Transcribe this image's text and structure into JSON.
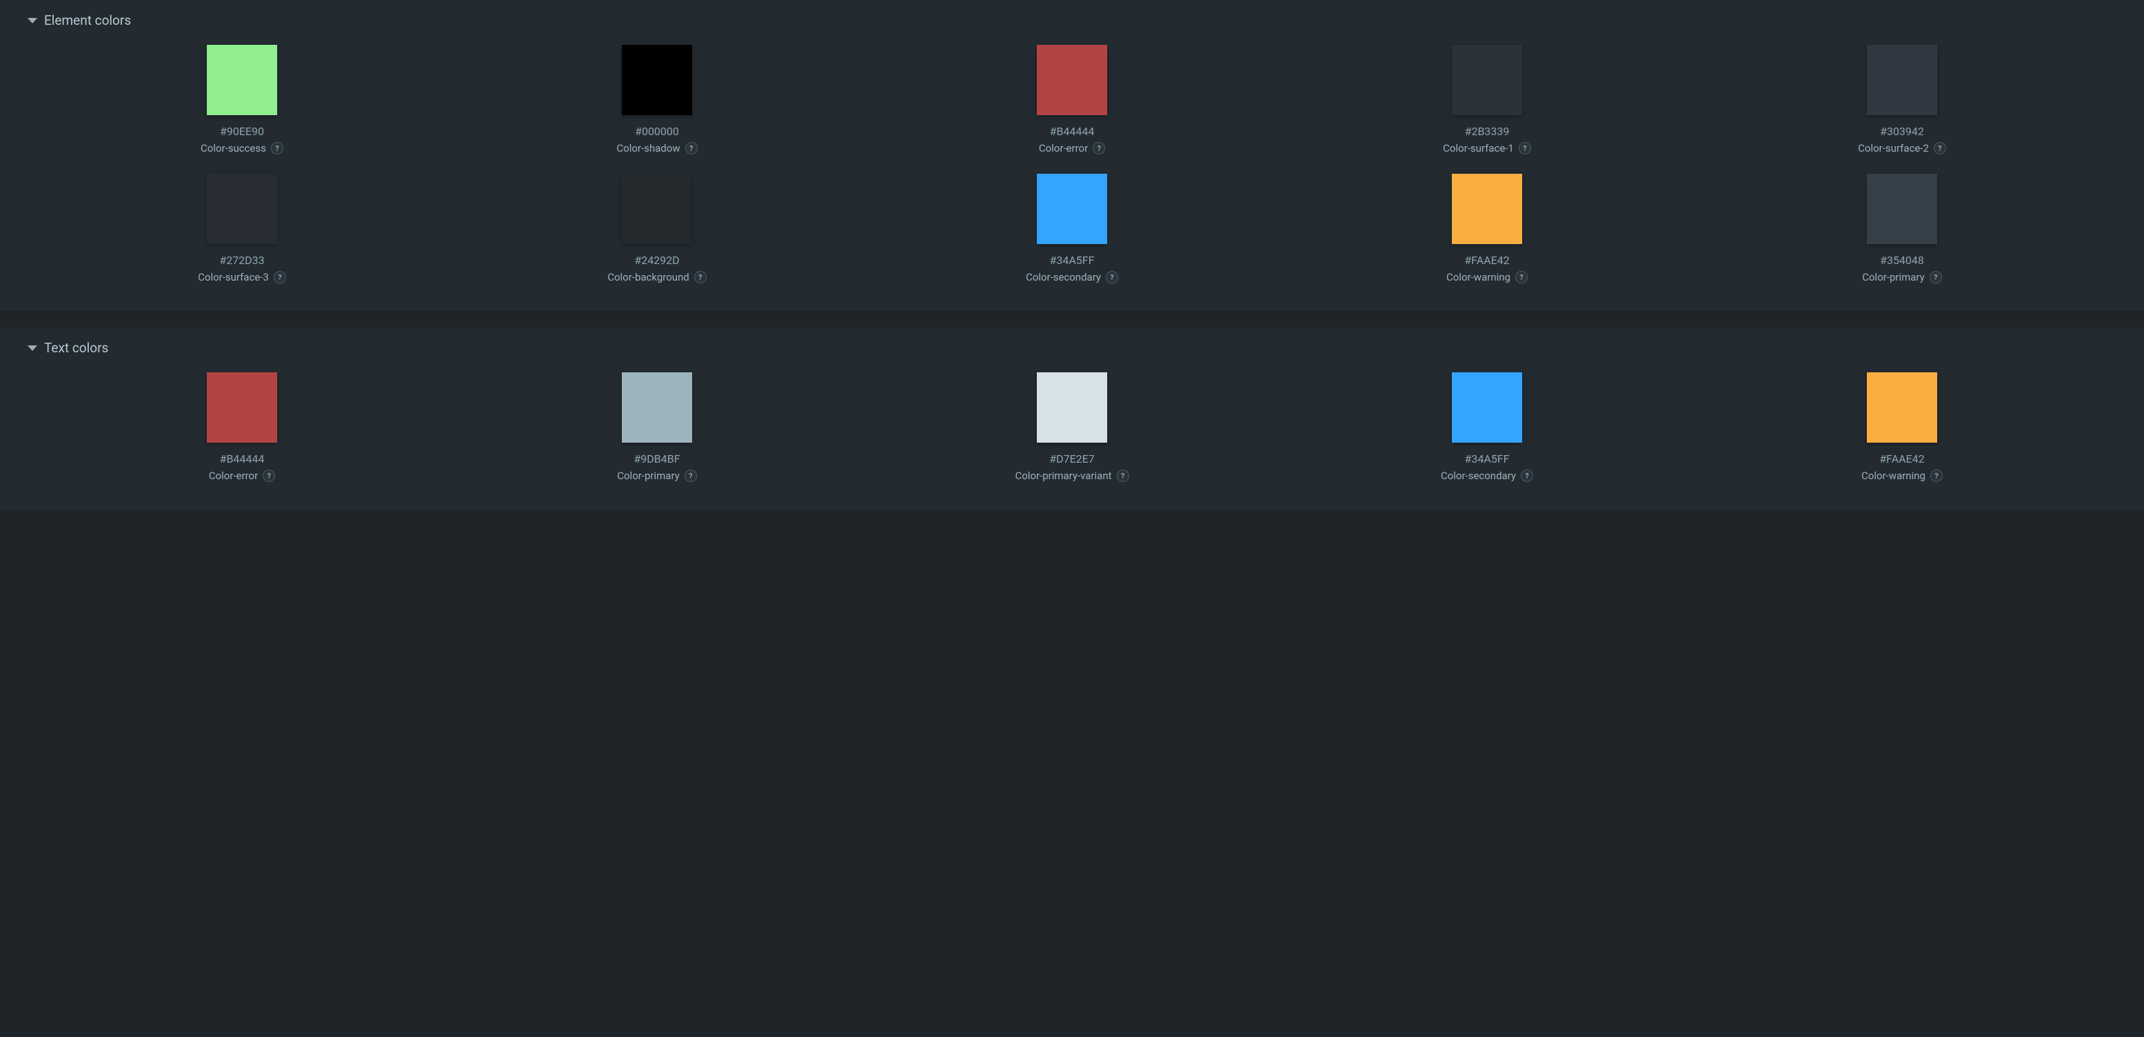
{
  "sections": [
    {
      "title": "Element colors",
      "swatches": [
        {
          "hex": "#90EE90",
          "name": "Color-success"
        },
        {
          "hex": "#000000",
          "name": "Color-shadow"
        },
        {
          "hex": "#B44444",
          "name": "Color-error"
        },
        {
          "hex": "#2B3339",
          "name": "Color-surface-1"
        },
        {
          "hex": "#303942",
          "name": "Color-surface-2"
        },
        {
          "hex": "#272D33",
          "name": "Color-surface-3"
        },
        {
          "hex": "#24292D",
          "name": "Color-background"
        },
        {
          "hex": "#34A5FF",
          "name": "Color-secondary"
        },
        {
          "hex": "#FAAE42",
          "name": "Color-warning"
        },
        {
          "hex": "#354048",
          "name": "Color-primary"
        }
      ]
    },
    {
      "title": "Text colors",
      "swatches": [
        {
          "hex": "#B44444",
          "name": "Color-error"
        },
        {
          "hex": "#9DB4BF",
          "name": "Color-primary"
        },
        {
          "hex": "#D7E2E7",
          "name": "Color-primary-variant"
        },
        {
          "hex": "#34A5FF",
          "name": "Color-secondary"
        },
        {
          "hex": "#FAAE42",
          "name": "Color-warning"
        }
      ]
    }
  ],
  "help_glyph": "?"
}
